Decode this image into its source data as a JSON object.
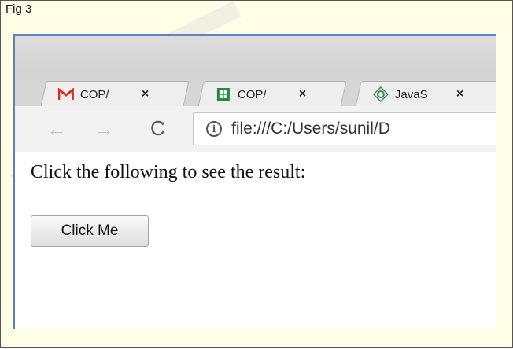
{
  "figure": {
    "label": "Fig 3"
  },
  "browser": {
    "tabs": [
      {
        "icon": "gmail-icon",
        "label": "COP/",
        "close": "×"
      },
      {
        "icon": "sheets-icon",
        "label": "COP/",
        "close": "×"
      },
      {
        "icon": "gear-icon",
        "label": "JavaS",
        "close": "×"
      }
    ],
    "toolbar": {
      "back": "←",
      "forward": "→",
      "reload": "C",
      "url": "file:///C:/Users/sunil/D"
    }
  },
  "page": {
    "prompt_text": "Click the following to see the result:",
    "button_label": "Click Me"
  },
  "colors": {
    "gmail_red": "#d93025",
    "sheets_green": "#1e8e3e",
    "chrome_blue": "#5e85c6"
  }
}
